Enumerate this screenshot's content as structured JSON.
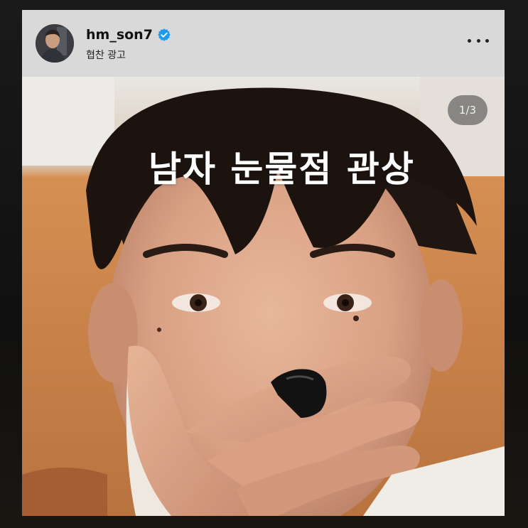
{
  "post": {
    "username": "hm_son7",
    "verified": true,
    "sponsored_label": "협찬 광고",
    "page_indicator": "1/3",
    "overlay_title": "남자 눈물점 관상"
  },
  "icons": {
    "verified": "verified-badge-icon",
    "more": "more-options-icon",
    "avatar": "profile-avatar"
  },
  "colors": {
    "header_bg": "#d9d9d9",
    "verified_blue": "#1d9bf0",
    "image_warm_bg": "#c8864e"
  }
}
